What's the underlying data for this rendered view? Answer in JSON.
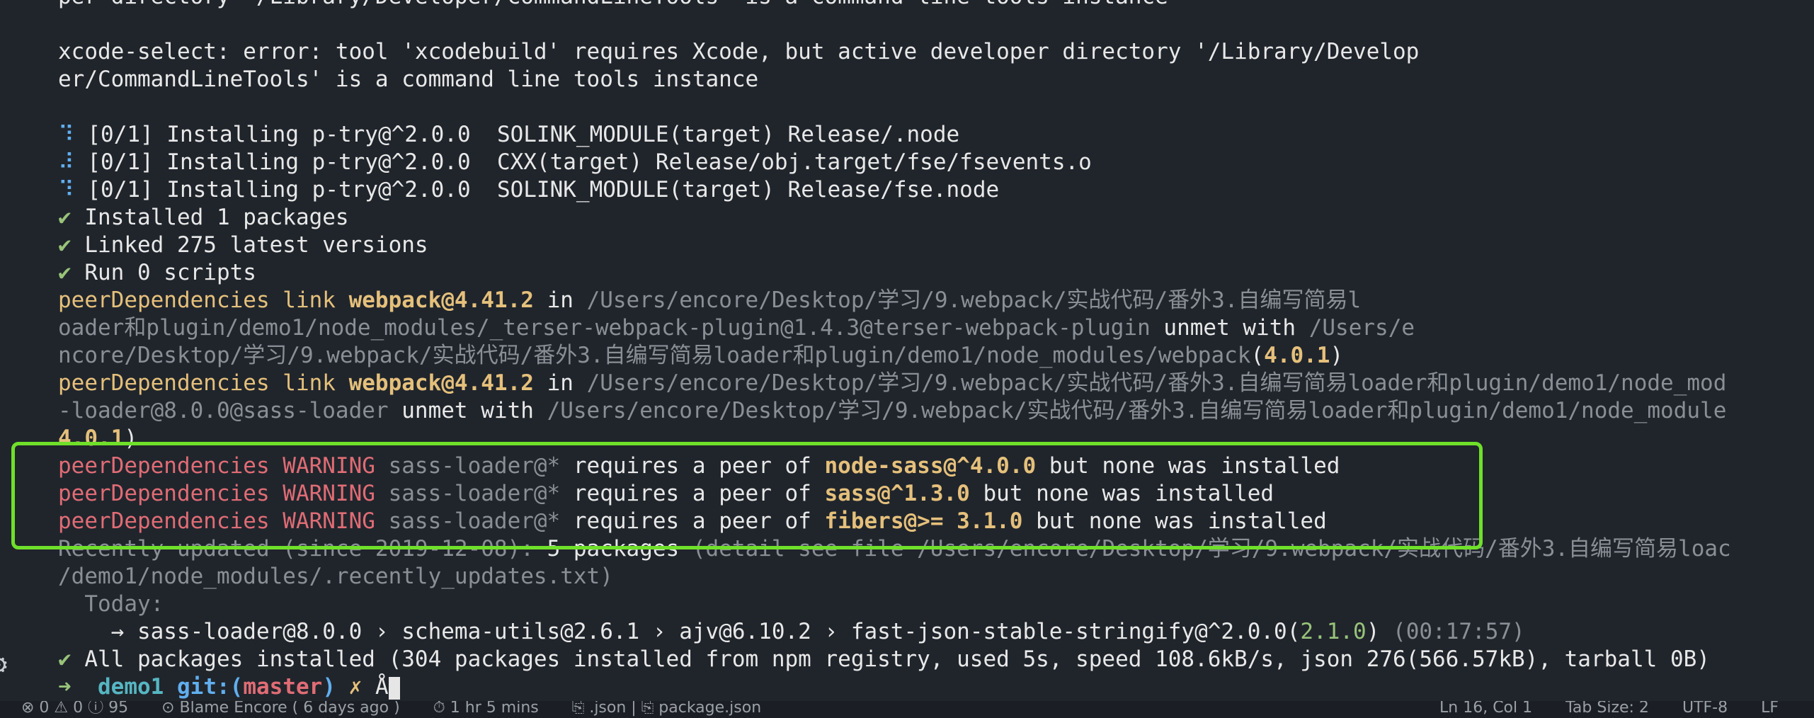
{
  "terminal": {
    "lines": [
      [
        {
          "t": "per directory '/Library/Developer/CommandLineTools' is a command line tools instance",
          "c": "white"
        }
      ],
      [],
      [
        {
          "t": "xcode-select: error: tool 'xcodebuild' requires Xcode, but active developer directory '/Library/Develop",
          "c": "white"
        }
      ],
      [
        {
          "t": "er/CommandLineTools' is a command line tools instance",
          "c": "white"
        }
      ],
      [],
      [
        {
          "t": "⠹ ",
          "c": "spin"
        },
        {
          "t": "[0/1] Installing p-try@^2.0.0  SOLINK_MODULE(target) Release/.node",
          "c": "white"
        }
      ],
      [
        {
          "t": "⠼ ",
          "c": "spin"
        },
        {
          "t": "[0/1] Installing p-try@^2.0.0  CXX(target) Release/obj.target/fse/fsevents.o",
          "c": "white"
        }
      ],
      [
        {
          "t": "⠹ ",
          "c": "spin"
        },
        {
          "t": "[0/1] Installing p-try@^2.0.0  SOLINK_MODULE(target) Release/fse.node",
          "c": "white"
        }
      ],
      [
        {
          "t": "✔ ",
          "c": "check"
        },
        {
          "t": "Installed 1 packages",
          "c": "white"
        }
      ],
      [
        {
          "t": "✔ ",
          "c": "check"
        },
        {
          "t": "Linked 275 latest versions",
          "c": "white"
        }
      ],
      [
        {
          "t": "✔ ",
          "c": "check"
        },
        {
          "t": "Run 0 scripts",
          "c": "white"
        }
      ],
      [
        {
          "t": "peerDependencies link ",
          "c": "yellow"
        },
        {
          "t": "webpack@4.41.2",
          "c": "yellow bold"
        },
        {
          "t": " in ",
          "c": "white"
        },
        {
          "t": "/Users/encore/Desktop/学习/9.webpack/实战代码/番外3.自编写简易l",
          "c": "gray"
        }
      ],
      [
        {
          "t": "oader和plugin/demo1/node_modules/_terser-webpack-plugin@1.4.3@terser-webpack-plugin",
          "c": "gray"
        },
        {
          "t": " unmet with ",
          "c": "white"
        },
        {
          "t": "/Users/e",
          "c": "gray"
        }
      ],
      [
        {
          "t": "ncore/Desktop/学习/9.webpack/实战代码/番外3.自编写简易loader和plugin/demo1/node_modules/webpack",
          "c": "gray"
        },
        {
          "t": "(",
          "c": "white"
        },
        {
          "t": "4.0.1",
          "c": "yellow bold"
        },
        {
          "t": ")",
          "c": "white"
        }
      ],
      [
        {
          "t": "peerDependencies link ",
          "c": "yellow"
        },
        {
          "t": "webpack@4.41.2",
          "c": "yellow bold"
        },
        {
          "t": " in ",
          "c": "white"
        },
        {
          "t": "/Users/encore/Desktop/学习/9.webpack/实战代码/番外3.自编写简易loader和plugin/demo1/node_mod",
          "c": "gray"
        }
      ],
      [
        {
          "t": "-loader@8.0.0@sass-loader",
          "c": "gray"
        },
        {
          "t": " unmet with ",
          "c": "white"
        },
        {
          "t": "/Users/encore/Desktop/学习/9.webpack/实战代码/番外3.自编写简易loader和plugin/demo1/node_module",
          "c": "gray"
        }
      ],
      [
        {
          "t": "4.0.1",
          "c": "yellow bold"
        },
        {
          "t": ")",
          "c": "white"
        }
      ],
      [
        {
          "t": "peerDependencies WARNING ",
          "c": "red"
        },
        {
          "t": "sass-loader@*",
          "c": "gray"
        },
        {
          "t": " requires a peer of ",
          "c": "white"
        },
        {
          "t": "node-sass@^4.0.0",
          "c": "yellow bold"
        },
        {
          "t": " but none was installed",
          "c": "white"
        }
      ],
      [
        {
          "t": "peerDependencies WARNING ",
          "c": "red"
        },
        {
          "t": "sass-loader@*",
          "c": "gray"
        },
        {
          "t": " requires a peer of ",
          "c": "white"
        },
        {
          "t": "sass@^1.3.0",
          "c": "yellow bold"
        },
        {
          "t": " but none was installed",
          "c": "white"
        }
      ],
      [
        {
          "t": "peerDependencies WARNING ",
          "c": "red"
        },
        {
          "t": "sass-loader@*",
          "c": "gray"
        },
        {
          "t": " requires a peer of ",
          "c": "white"
        },
        {
          "t": "fibers@>= 3.1.0",
          "c": "yellow bold"
        },
        {
          "t": " but none was installed",
          "c": "white"
        }
      ],
      [
        {
          "t": "Recently updated (since 2019-12-08): ",
          "c": "gray"
        },
        {
          "t": "5 packages",
          "c": "white"
        },
        {
          "t": " (detail see file /Users/encore/Desktop/学习/9.webpack/实战代码/番外3.自编写简易loac",
          "c": "gray"
        }
      ],
      [
        {
          "t": "/demo1/node_modules/.recently_updates.txt)",
          "c": "gray"
        }
      ],
      [
        {
          "t": "  Today:",
          "c": "gray"
        }
      ],
      [
        {
          "t": "    → sass-loader@8.0.0 › schema-utils@2.6.1 › ajv@6.10.2 › fast-json-stable-stringify@^2.0.0(",
          "c": "white"
        },
        {
          "t": "2.1.0",
          "c": "green"
        },
        {
          "t": ")",
          "c": "white"
        },
        {
          "t": " (00:17:57)",
          "c": "gray"
        }
      ],
      [
        {
          "t": "✔ ",
          "c": "check"
        },
        {
          "t": "All packages installed (304 packages installed from npm registry, used 5s, speed 108.6kB/s, json 276(566.57kB), tarball 0B)",
          "c": "white"
        }
      ]
    ],
    "prompt": {
      "arrow": "➜",
      "dir": "demo1",
      "git_label": "git:(",
      "branch": "master",
      "git_close": ")",
      "dirty": "✗",
      "input": "Å"
    }
  },
  "statusbar": {
    "left_items": [
      "⊗ 0 ⚠ 0 ⓘ 95",
      "⊙ Blame Encore ( 6 days ago )",
      "⏱ 1 hr 5 mins",
      "⎘ .json | ⎘ package.json"
    ],
    "right_items": [
      "Ln 16, Col 1",
      "Tab Size: 2",
      "UTF-8",
      "LF"
    ]
  },
  "icons": {
    "gear": "gear-icon"
  },
  "colors": {
    "background": "#20252c",
    "highlight": "#6fe02a"
  }
}
